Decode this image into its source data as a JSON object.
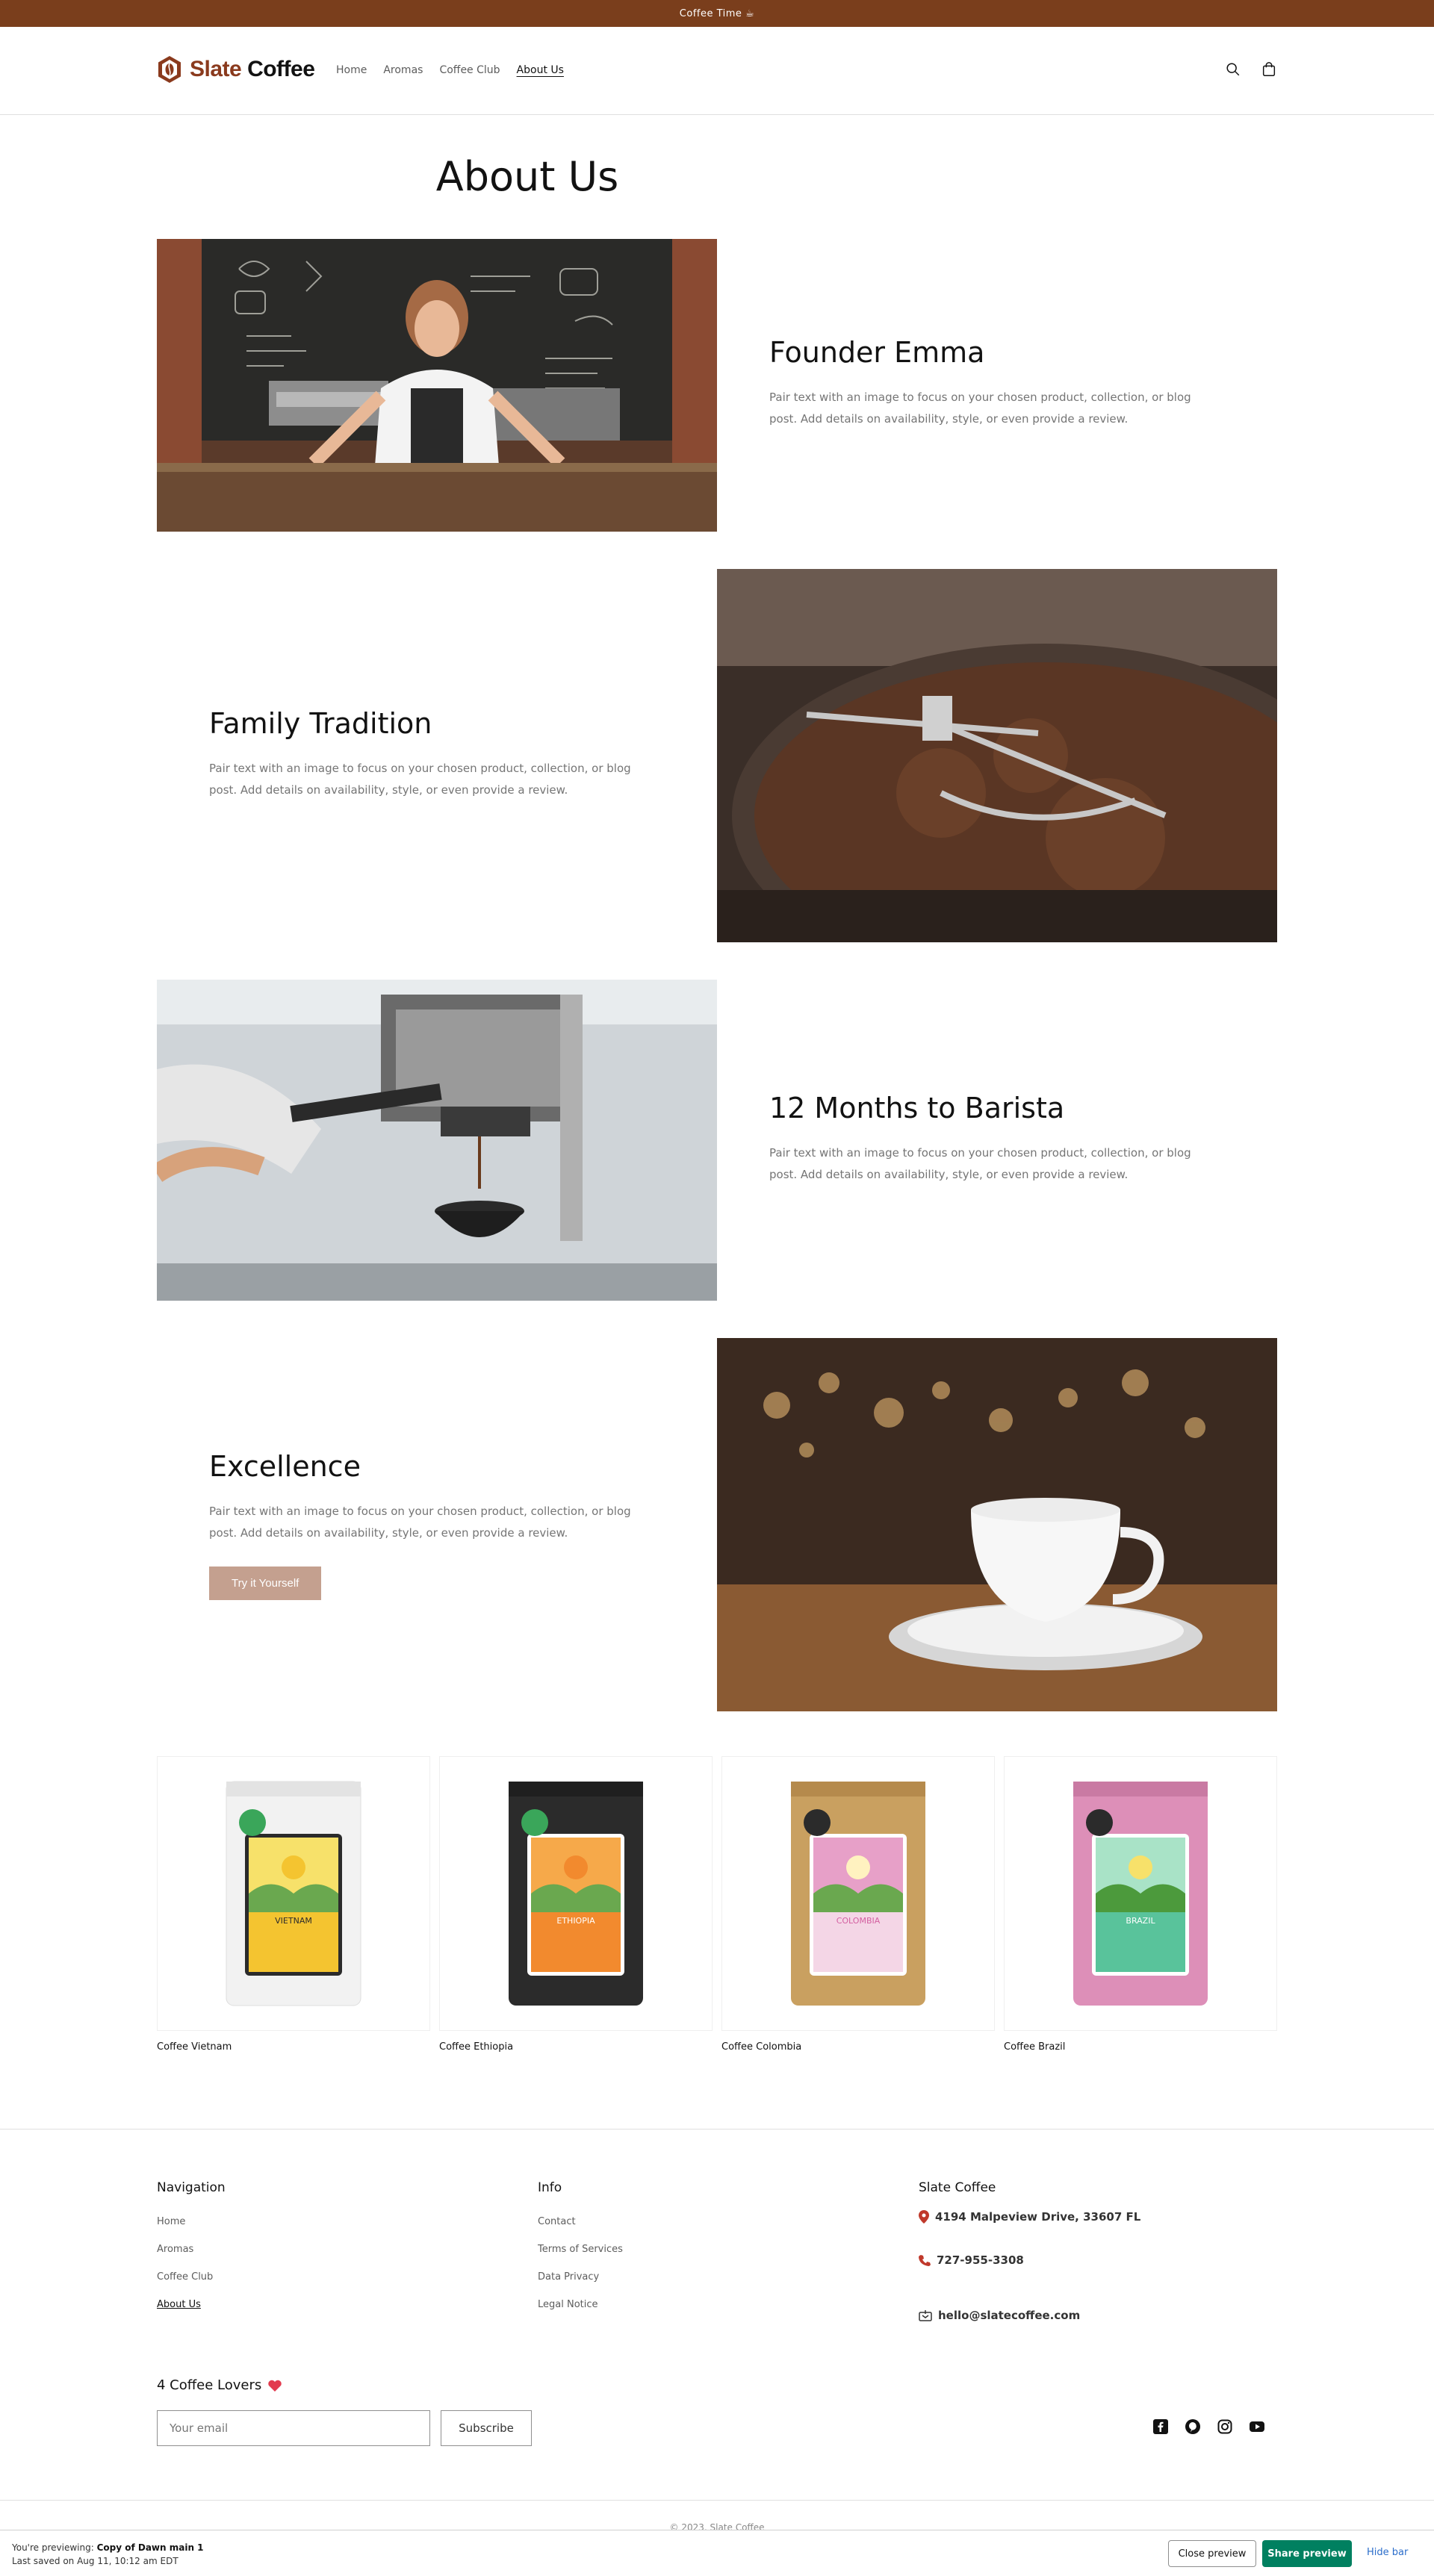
{
  "announcement": {
    "text": "Coffee Time ☕"
  },
  "header": {
    "logo": {
      "word1": "Slate",
      "word2": "Coffee"
    },
    "nav": [
      {
        "label": "Home"
      },
      {
        "label": "Aromas"
      },
      {
        "label": "Coffee Club"
      },
      {
        "label": "About Us",
        "active": true
      }
    ],
    "icons": [
      "search-icon",
      "cart-icon"
    ]
  },
  "page": {
    "title": "About Us"
  },
  "sections": [
    {
      "heading": "Founder Emma",
      "body": "Pair text with an image to focus on your chosen product, collection, or blog post. Add details on availability, style, or even provide a review.",
      "image": "barista-woman-photo"
    },
    {
      "heading": "Family Tradition",
      "body": "Pair text with an image to focus on your chosen product, collection, or blog post. Add details on availability, style, or even provide a review.",
      "image": "coffee-roaster-photo"
    },
    {
      "heading": "12 Months to Barista",
      "body": "Pair text with an image to focus on your chosen product, collection, or blog post. Add details on availability, style, or even provide a review.",
      "image": "espresso-machine-photo"
    },
    {
      "heading": "Excellence",
      "body": "Pair text with an image to focus on your chosen product, collection, or blog post. Add details on availability, style, or even provide a review.",
      "button": "Try it Yourself",
      "image": "coffee-cup-photo"
    }
  ],
  "products": [
    {
      "title": "Coffee Vietnam",
      "label": "VIETNAM",
      "bag_color": "#f2f2f2",
      "label_color": "#f4c430",
      "sky_color": "#f7e16a"
    },
    {
      "title": "Coffee Ethiopia",
      "label": "ETHIOPIA",
      "bag_color": "#2b2b2b",
      "label_color": "#f28a2e",
      "sky_color": "#f6a94a"
    },
    {
      "title": "Coffee Colombia",
      "label": "COLOMBIA",
      "bag_color": "#c9a060",
      "label_color": "#d35fa0",
      "sky_color": "#e7a0c8"
    },
    {
      "title": "Coffee Brazil",
      "label": "BRAZIL",
      "bag_color": "#dd8fb8",
      "label_color": "#59c39b",
      "sky_color": "#a9e3c7"
    }
  ],
  "footer": {
    "navigation": {
      "heading": "Navigation",
      "links": [
        "Home",
        "Aromas",
        "Coffee Club",
        "About Us"
      ]
    },
    "info": {
      "heading": "Info",
      "links": [
        "Contact",
        "Terms of Services",
        "Data Privacy",
        "Legal Notice"
      ]
    },
    "contact": {
      "heading": "Slate Coffee",
      "address": "4194 Malpeview Drive, 33607 FL",
      "phone": "727-955-3308",
      "email": "hello@slatecoffee.com"
    },
    "newsletter": {
      "heading": "4 Coffee Lovers",
      "placeholder": "Your email",
      "button": "Subscribe"
    },
    "socials": [
      "facebook-icon",
      "pinterest-icon",
      "instagram-icon",
      "youtube-icon"
    ],
    "copyright": "© 2023, Slate Coffee"
  },
  "preview_bar": {
    "prefix": "You're previewing:",
    "theme_name": "Copy of Dawn main 1",
    "saved": "Last saved on Aug 11, 10:12 am EDT",
    "close": "Close preview",
    "share": "Share preview",
    "hide": "Hide bar"
  },
  "colors": {
    "accent": "#7a3e1c",
    "button": "#c4a08f",
    "share": "#008060"
  }
}
